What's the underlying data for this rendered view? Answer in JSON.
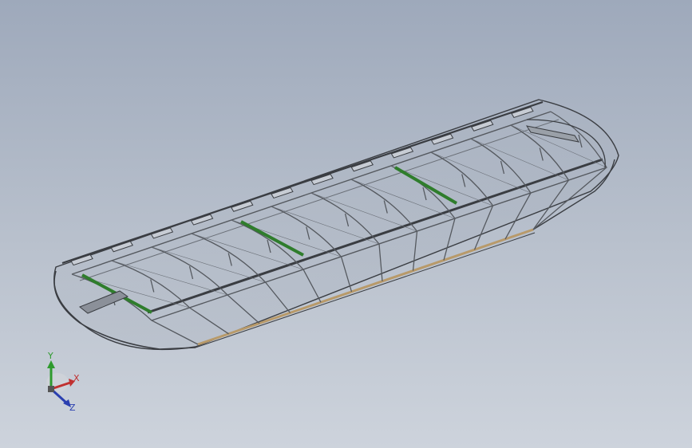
{
  "viewport": {
    "background_top": "#9ea9bb",
    "background_bottom": "#cdd3dc"
  },
  "model": {
    "frame_color": "#3a3d42",
    "structure_color": "#55595f",
    "strut_color": "#6b7078",
    "tube_color": "#2f7d2c",
    "trailing_edge_color": "#b89a6a",
    "skin_color": "#aeb5c0"
  },
  "triad": {
    "x_label": "X",
    "y_label": "Y",
    "z_label": "Z",
    "x_color": "#c03030",
    "y_color": "#2e9a2e",
    "z_color": "#2a3fb0",
    "icon": "coordinate-triad-icon"
  }
}
